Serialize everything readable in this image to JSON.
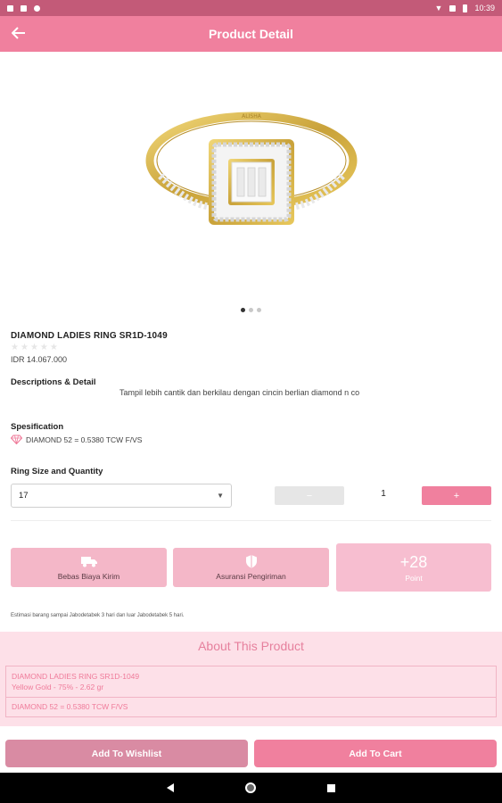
{
  "status_bar": {
    "time": "10:39"
  },
  "app_bar": {
    "title": "Product Detail"
  },
  "gallery": {
    "page_count": 3,
    "active_index": 0,
    "engraving": "ALISHA"
  },
  "product": {
    "name": "DIAMOND LADIES RING SR1D-1049",
    "rating": 0,
    "rating_max": 5,
    "price": "IDR 14.067.000",
    "descriptions_label": "Descriptions & Detail",
    "description": "Tampil lebih cantik dan berkilau dengan cincin berlian diamond n co",
    "spec_label": "Spesification",
    "spec_value": "DIAMOND 52 = 0.5380 TCW F/VS",
    "size_qty_label": "Ring Size and Quantity",
    "ring_size": "17",
    "quantity": "1",
    "minus_label": "−",
    "plus_label": "+"
  },
  "features": {
    "shipping_label": "Bebas Biaya Kirim",
    "insurance_label": "Asuransi Pengiriman",
    "points_value": "+28",
    "points_label": "Point"
  },
  "note": "Estimasi barang sampai Jabodetabek 3 hari dan luar Jabodetabek 5 hari.",
  "about": {
    "title": "About This Product",
    "line1": "DIAMOND LADIES RING SR1D-1049",
    "line2": "Yellow Gold - 75% - 2.62 gr",
    "line3": "DIAMOND 52 = 0.5380 TCW F/VS"
  },
  "actions": {
    "wishlist_label": "Add To Wishlist",
    "cart_label": "Add To Cart"
  },
  "colors": {
    "primary": "#f0809e",
    "status_bar": "#c35a78",
    "feature_bg": "#f4b7c8",
    "about_bg": "#fde0e8"
  }
}
